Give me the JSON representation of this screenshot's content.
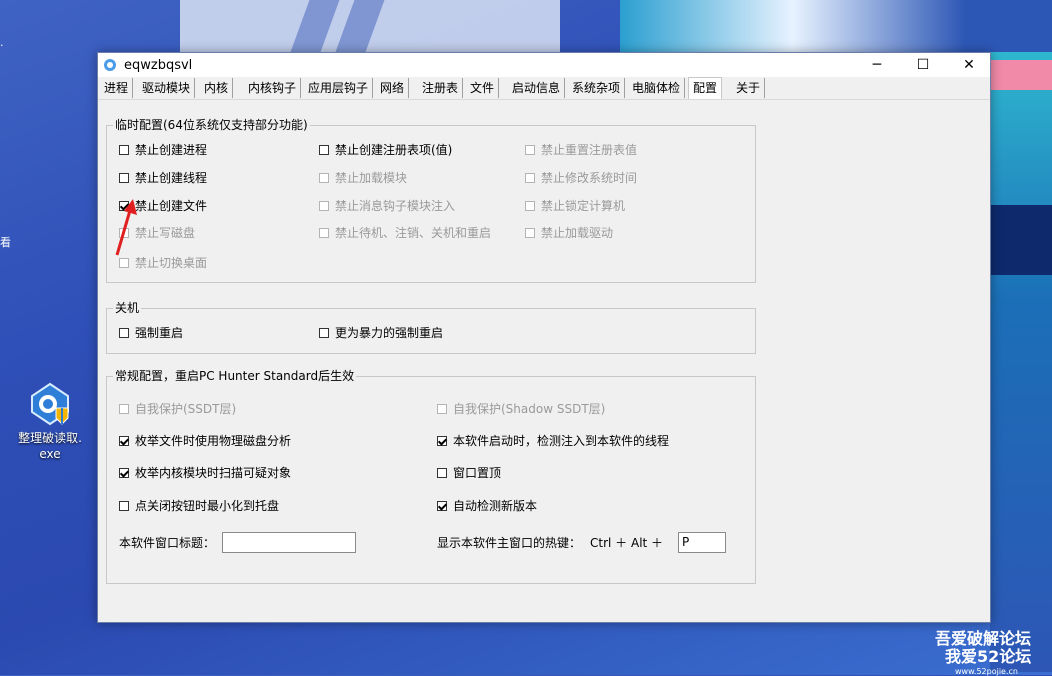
{
  "desktop": {
    "icon_label_line1": "整理破读取.",
    "icon_label_line2": "exe",
    "left_glyph": "看",
    "watermark": {
      "line1": "吾爱破解论坛",
      "line2": "我爱52论坛",
      "line3": "www.52pojie.cn"
    }
  },
  "window": {
    "title": "eqwzbqsvl",
    "controls": {
      "minimize": "─",
      "maximize": "☐",
      "close": "✕"
    },
    "tabs": [
      {
        "label": "进程"
      },
      {
        "label": "驱动模块"
      },
      {
        "label": "内核"
      },
      {
        "label": "内核钩子"
      },
      {
        "label": "应用层钩子"
      },
      {
        "label": "网络"
      },
      {
        "label": "注册表"
      },
      {
        "label": "文件"
      },
      {
        "label": "启动信息"
      },
      {
        "label": "系统杂项"
      },
      {
        "label": "电脑体检"
      },
      {
        "label": "配置"
      },
      {
        "label": "关于"
      }
    ],
    "active_tab": "配置",
    "temp_config": {
      "title": "临时配置(64位系统仅支持部分功能)",
      "items": [
        {
          "label": "禁止创建进程",
          "checked": false,
          "disabled": false
        },
        {
          "label": "禁止创建注册表项(值)",
          "checked": false,
          "disabled": false
        },
        {
          "label": "禁止重置注册表值",
          "checked": false,
          "disabled": true
        },
        {
          "label": "禁止创建线程",
          "checked": false,
          "disabled": false
        },
        {
          "label": "禁止加载模块",
          "checked": false,
          "disabled": true
        },
        {
          "label": "禁止修改系统时间",
          "checked": false,
          "disabled": true
        },
        {
          "label": "禁止创建文件",
          "checked": true,
          "disabled": false
        },
        {
          "label": "禁止消息钩子模块注入",
          "checked": false,
          "disabled": true
        },
        {
          "label": "禁止锁定计算机",
          "checked": false,
          "disabled": true
        },
        {
          "label": "禁止写磁盘",
          "checked": false,
          "disabled": true
        },
        {
          "label": "禁止待机、注销、关机和重启",
          "checked": false,
          "disabled": true
        },
        {
          "label": "禁止加载驱动",
          "checked": false,
          "disabled": true
        },
        {
          "label": "禁止切换桌面",
          "checked": false,
          "disabled": true
        }
      ]
    },
    "shutdown": {
      "title": "关机",
      "items": [
        {
          "label": "强制重启",
          "checked": false,
          "disabled": false
        },
        {
          "label": "更为暴力的强制重启",
          "checked": false,
          "disabled": false
        }
      ]
    },
    "general_config": {
      "title": "常规配置，重启PC Hunter Standard后生效",
      "items": [
        {
          "label": "自我保护(SSDT层)",
          "checked": false,
          "disabled": true
        },
        {
          "label": "自我保护(Shadow SSDT层)",
          "checked": false,
          "disabled": true
        },
        {
          "label": "枚举文件时使用物理磁盘分析",
          "checked": true,
          "disabled": false
        },
        {
          "label": "本软件启动时，检测注入到本软件的线程",
          "checked": true,
          "disabled": false
        },
        {
          "label": "枚举内核模块时扫描可疑对象",
          "checked": true,
          "disabled": false
        },
        {
          "label": "窗口置顶",
          "checked": false,
          "disabled": false
        },
        {
          "label": "点关闭按钮时最小化到托盘",
          "checked": false,
          "disabled": false
        },
        {
          "label": "自动检测新版本",
          "checked": true,
          "disabled": false
        }
      ],
      "window_title_label": "本软件窗口标题：",
      "window_title_value": "",
      "hotkey_label": "显示本软件主窗口的热键：",
      "hotkey_prefix": "Ctrl ＋ Alt ＋",
      "hotkey_value": "P"
    }
  }
}
